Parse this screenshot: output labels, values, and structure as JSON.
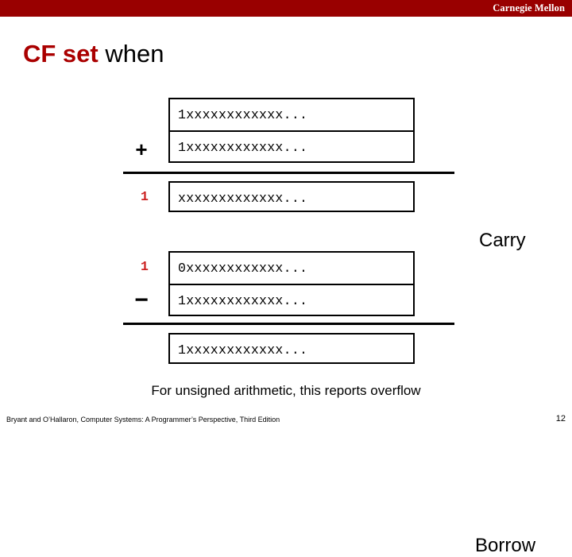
{
  "header": {
    "brand": "Carnegie Mellon",
    "bar_color": "#990000"
  },
  "title": {
    "accent_text": "CF set",
    "accent_color": "#aa0000",
    "rest_text": " when"
  },
  "carry_group": {
    "operator": "+",
    "operand1": "1xxxxxxxxxxxx...",
    "operand2": "1xxxxxxxxxxxx...",
    "carry_out": "1",
    "carry_out_color": "#cc2222",
    "result": "xxxxxxxxxxxxx...",
    "side_label": "Carry"
  },
  "borrow_group": {
    "operator": "−",
    "borrow_in": "1",
    "borrow_in_color": "#cc2222",
    "operand1": "0xxxxxxxxxxxx...",
    "operand2": "1xxxxxxxxxxxx...",
    "result": "1xxxxxxxxxxxx...",
    "side_label": "Borrow"
  },
  "caption": "For unsigned arithmetic, this reports overflow",
  "footer": {
    "citation": "Bryant and O’Hallaron, Computer Systems: A Programmer’s Perspective, Third Edition",
    "page_number": "12"
  }
}
